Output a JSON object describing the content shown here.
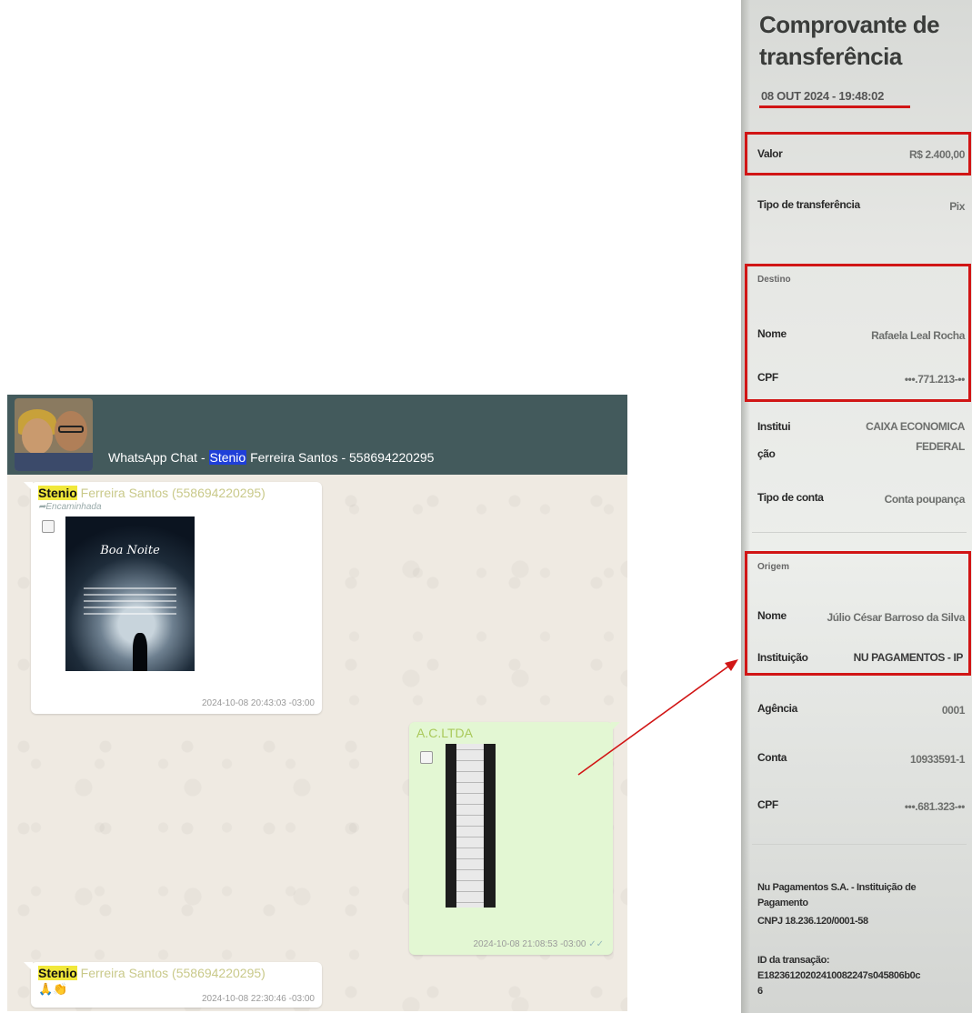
{
  "whatsapp": {
    "header_prefix": "WhatsApp Chat - ",
    "header_highlight": "Stenio",
    "header_suffix": " Ferreira Santos - 558694220295",
    "messages": [
      {
        "sender_highlight": "Stenio",
        "sender_rest": " Ferreira Santos (558694220295)",
        "forwarded_label": "Encaminhada",
        "image_caption": "Boa Noite",
        "timestamp": "2024-10-08 20:43:03 -03:00"
      },
      {
        "sender": "A.C.LTDA",
        "timestamp": "2024-10-08 21:08:53 -03:00",
        "ticks": "✓✓"
      },
      {
        "sender_highlight": "Stenio",
        "sender_rest": " Ferreira Santos (558694220295)",
        "emoji": "🙏👏",
        "timestamp": "2024-10-08 22:30:46 -03:00"
      }
    ]
  },
  "receipt": {
    "title": "Comprovante de transferência",
    "date": "08 OUT 2024 - 19:48:02",
    "valor_label": "Valor",
    "valor_value": "R$ 2.400,00",
    "tipo_transferencia_label": "Tipo de transferência",
    "tipo_transferencia_value": "Pix",
    "destino_section": "Destino",
    "destino_nome_label": "Nome",
    "destino_nome_value": "Rafaela Leal Rocha",
    "destino_cpf_label": "CPF",
    "destino_cpf_value": "•••.771.213-••",
    "destino_instituicao_label_1": "Institui",
    "destino_instituicao_label_2": "ção",
    "destino_instituicao_value_1": "CAIXA ECONOMICA",
    "destino_instituicao_value_2": "FEDERAL",
    "tipo_conta_label": "Tipo de conta",
    "tipo_conta_value": "Conta poupança",
    "origem_section": "Origem",
    "origem_nome_label": "Nome",
    "origem_nome_value": "Júlio César Barroso da Silva",
    "origem_instituicao_label": "Instituição",
    "origem_instituicao_value": "NU PAGAMENTOS - IP",
    "agencia_label": "Agência",
    "agencia_value": "0001",
    "conta_label": "Conta",
    "conta_value": "10933591-1",
    "origem_cpf_label": "CPF",
    "origem_cpf_value": "•••.681.323-••",
    "footer_company_1": "Nu Pagamentos S.A. - Instituição de",
    "footer_company_2": "Pagamento",
    "footer_cnpj": "CNPJ 18.236.120/0001-58",
    "id_label": "ID da transação:",
    "id_value_1": "E18236120202410082247s045806b0c",
    "id_value_2": "6"
  },
  "colors": {
    "highlight_red": "#d11515",
    "wa_header": "#435a5c",
    "wa_background": "#efeae2",
    "outgoing_bubble": "#e3f7d3"
  }
}
